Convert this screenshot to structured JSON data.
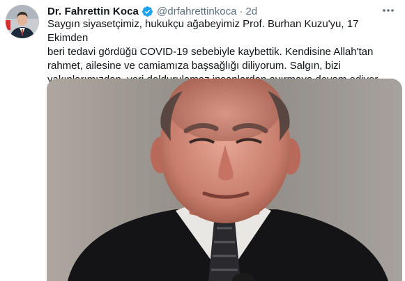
{
  "tweet": {
    "author_name": "Dr. Fahrettin Koca",
    "author_handle": "@drfahrettinkoca",
    "separator": "·",
    "time": "2d",
    "text": "Saygın siyasetçimiz, hukukçu ağabeyimiz Prof. Burhan Kuzu'yu, 17 Ekimden\nberi tedavi gördüğü COVID-19 sebebiyle kaybettik. Kendisine Allah'tan\nrahmet, ailesine ve camiamıza başsağlığı diliyorum. Salgın, bizi\nyakınlarımızdan, yeri doldurulamaz insanlardan ayırmaya devam ediyor.",
    "icons": {
      "verified": "verified-badge-icon",
      "more": "more-options-icon"
    },
    "colors": {
      "verified_badge": "#1da1f2",
      "secondary_text": "#5b7083",
      "primary_text": "#0f1419"
    }
  }
}
